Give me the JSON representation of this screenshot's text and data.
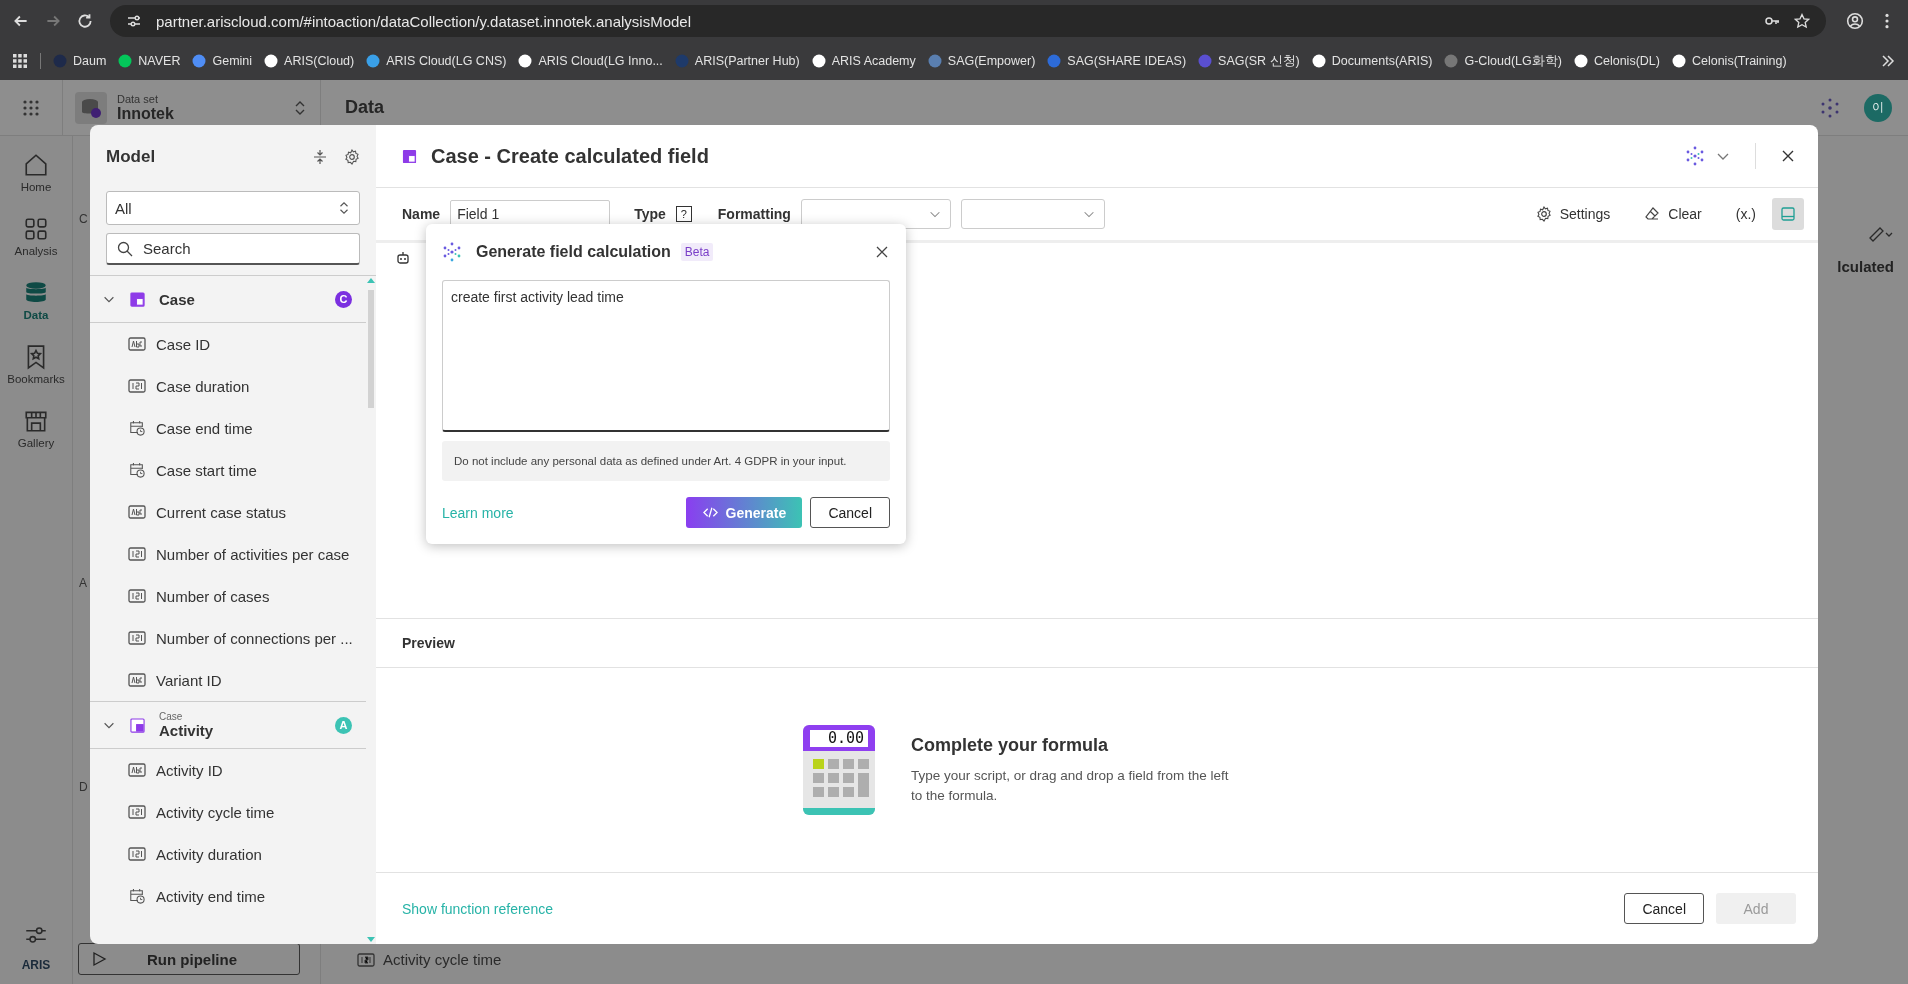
{
  "browser": {
    "url": "partner.ariscloud.com/#intoaction/dataCollection/y.dataset.innotek.analysisModel",
    "bookmarks": [
      {
        "label": "Daum",
        "color": "#1e2a4a"
      },
      {
        "label": "NAVER",
        "color": "#03c75a"
      },
      {
        "label": "Gemini",
        "color": "#4f8df5"
      },
      {
        "label": "ARIS(Cloud)",
        "color": "#ffffff"
      },
      {
        "label": "ARIS Cloud(LG CNS)",
        "color": "#3aa0e8"
      },
      {
        "label": "ARIS Cloud(LG Inno...",
        "color": "#ffffff"
      },
      {
        "label": "ARIS(Partner Hub)",
        "color": "#1e3a6a"
      },
      {
        "label": "ARIS Academy",
        "color": "#ffffff"
      },
      {
        "label": "SAG(Empower)",
        "color": "#5a7fb0"
      },
      {
        "label": "SAG(SHARE IDEAS)",
        "color": "#2d6bd8"
      },
      {
        "label": "SAG(SR 신청)",
        "color": "#5a4fd0"
      },
      {
        "label": "Documents(ARIS)",
        "color": "#ffffff"
      },
      {
        "label": "G-Cloud(LG화학)",
        "color": "#777777"
      },
      {
        "label": "Celonis(DL)",
        "color": "#ffffff"
      },
      {
        "label": "Celonis(Training)",
        "color": "#ffffff"
      }
    ]
  },
  "app": {
    "dataset_label": "Data set",
    "dataset_name": "Innotek",
    "page_title": "Data",
    "avatar": "이",
    "nav": [
      {
        "label": "Home",
        "selected": false
      },
      {
        "label": "Analysis",
        "selected": false
      },
      {
        "label": "Data",
        "selected": true
      },
      {
        "label": "Bookmarks",
        "selected": false
      },
      {
        "label": "Gallery",
        "selected": false
      }
    ],
    "brand": "ARIS",
    "section_letters": [
      "C",
      "A",
      "D"
    ],
    "run_button": "Run pipeline",
    "column_fragment": "lculated",
    "list_item_behind": "Activity cycle time"
  },
  "model": {
    "title": "Model",
    "filter": "All",
    "search_placeholder": "Search",
    "groups": [
      {
        "name": "Case",
        "badge": "C",
        "color": "#7b2fe0",
        "expanded": true,
        "fields": [
          {
            "name": "Case ID",
            "kind": "text"
          },
          {
            "name": "Case duration",
            "kind": "number"
          },
          {
            "name": "Case end time",
            "kind": "datetime"
          },
          {
            "name": "Case start time",
            "kind": "datetime"
          },
          {
            "name": "Current case status",
            "kind": "text"
          },
          {
            "name": "Number of activities per case",
            "kind": "number"
          },
          {
            "name": "Number of cases",
            "kind": "number"
          },
          {
            "name": "Number of connections per ...",
            "kind": "number"
          },
          {
            "name": "Variant ID",
            "kind": "text"
          }
        ]
      },
      {
        "parent": "Case",
        "name": "Activity",
        "badge": "A",
        "color": "#3cc3b4",
        "expanded": true,
        "fields": [
          {
            "name": "Activity ID",
            "kind": "text"
          },
          {
            "name": "Activity cycle time",
            "kind": "number"
          },
          {
            "name": "Activity duration",
            "kind": "number"
          },
          {
            "name": "Activity end time",
            "kind": "datetime"
          }
        ]
      }
    ]
  },
  "dialog": {
    "title": "Case - Create calculated field",
    "name_label": "Name",
    "name_value": "Field 1",
    "type_label": "Type",
    "type_value": "?",
    "formatting_label": "Formatting",
    "settings": "Settings",
    "clear": "Clear",
    "variables": "(x.)",
    "panel_toggle_selected": true,
    "popup": {
      "title": "Generate field calculation",
      "badge": "Beta",
      "prompt": "create first activity lead time",
      "notice": "Do not include any personal data as defined under Art. 4 GDPR in your input.",
      "learn_more": "Learn more",
      "generate": "Generate",
      "cancel": "Cancel"
    },
    "preview": {
      "label": "Preview",
      "calculator_display": "0.00",
      "heading": "Complete your formula",
      "text": "Type your script, or drag and drop a field from the left to the formula."
    },
    "footer": {
      "link": "Show function reference",
      "cancel": "Cancel",
      "add": "Add",
      "add_disabled": true
    }
  }
}
